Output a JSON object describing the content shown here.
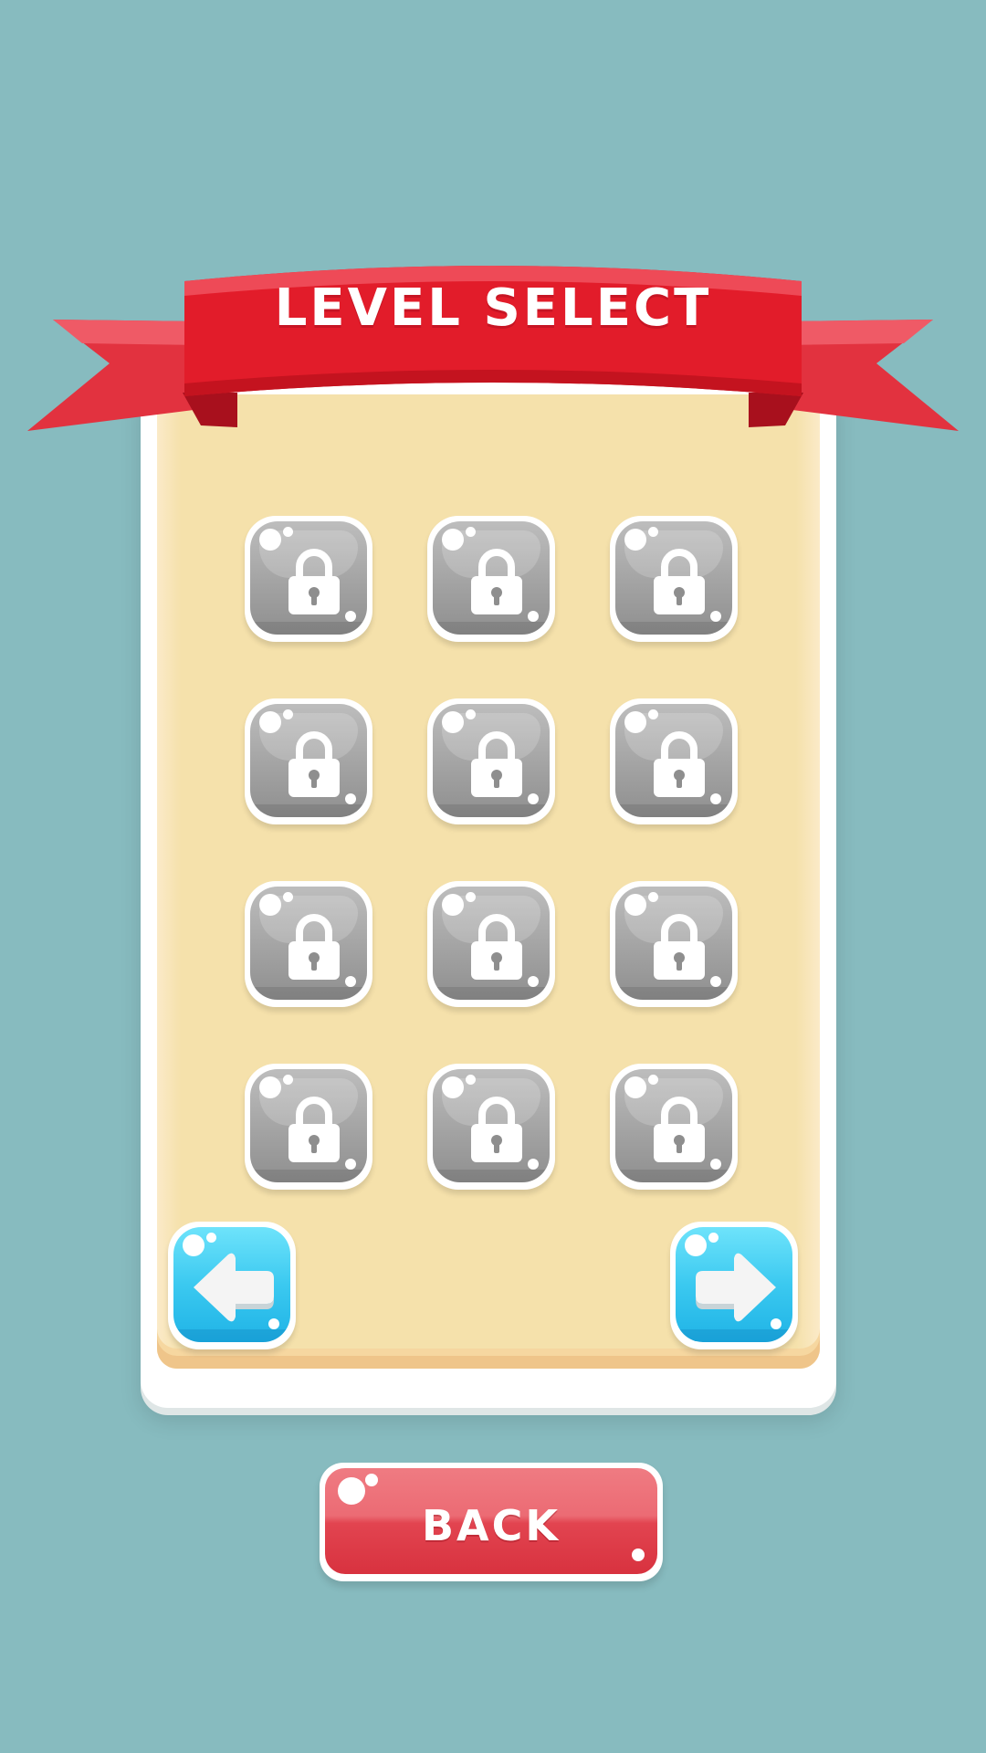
{
  "screen": {
    "title": "LEVEL SELECT",
    "background_color": "#87bbbf",
    "ribbon_color": "#e21c2a"
  },
  "levels": {
    "count": 12,
    "state": "locked",
    "icon": "lock-icon",
    "items": [
      {
        "state": "locked"
      },
      {
        "state": "locked"
      },
      {
        "state": "locked"
      },
      {
        "state": "locked"
      },
      {
        "state": "locked"
      },
      {
        "state": "locked"
      },
      {
        "state": "locked"
      },
      {
        "state": "locked"
      },
      {
        "state": "locked"
      },
      {
        "state": "locked"
      },
      {
        "state": "locked"
      },
      {
        "state": "locked"
      }
    ]
  },
  "navigation": {
    "prev_icon": "arrow-left-icon",
    "next_icon": "arrow-right-icon",
    "accent_color": "#3bc9f0"
  },
  "back_button": {
    "label": "BACK",
    "color": "#e24450"
  }
}
